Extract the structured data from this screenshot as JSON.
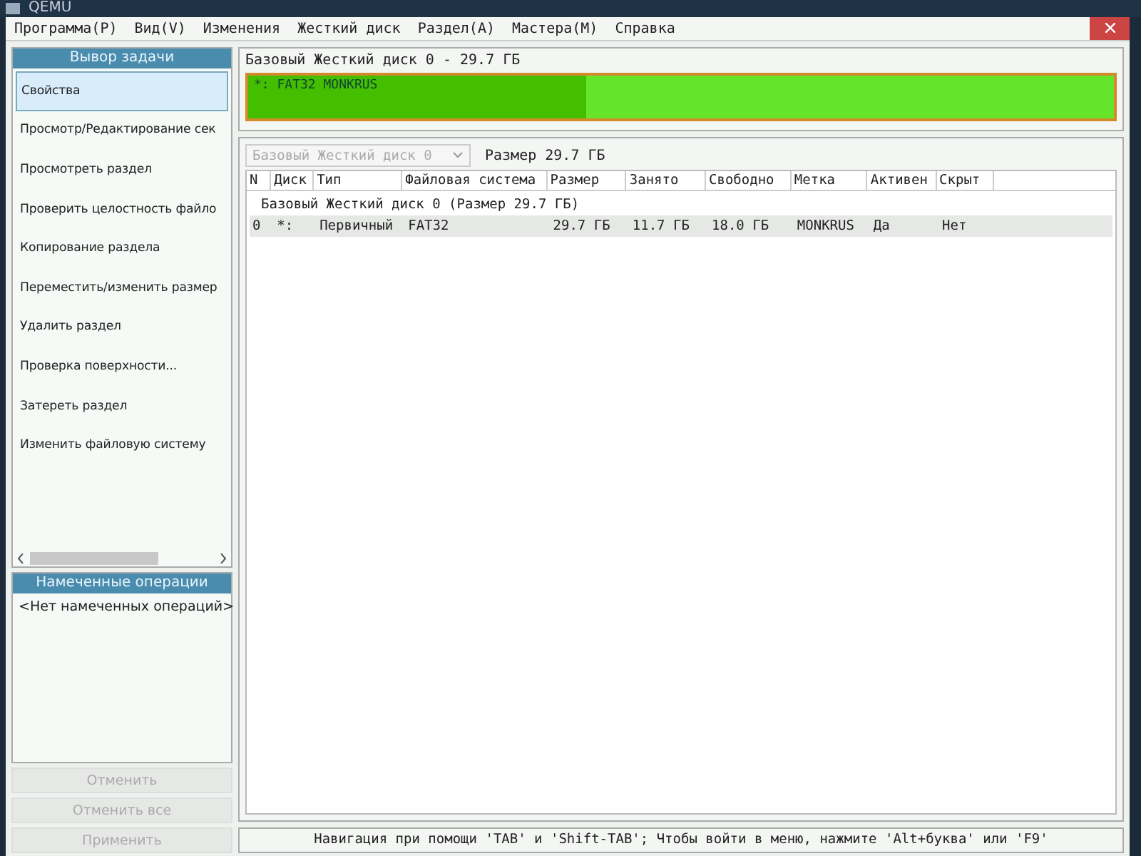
{
  "window": {
    "title": "QEMU"
  },
  "menu": [
    "Программа(P)",
    "Вид(V)",
    "Изменения",
    "Жесткий диск",
    "Раздел(A)",
    "Мастера(M)",
    "Справка"
  ],
  "task_panel": {
    "title": "Вывор задачи",
    "items": [
      {
        "label": "Свойства",
        "selected": true
      },
      {
        "label": "Просмотр/Редактирование сек",
        "selected": false
      },
      {
        "label": "Просмотреть раздел",
        "selected": false
      },
      {
        "label": "Проверить целостность файло",
        "selected": false
      },
      {
        "label": "Копирование раздела",
        "selected": false
      },
      {
        "label": "Переместить/изменить размер",
        "selected": false
      },
      {
        "label": "Удалить раздел",
        "selected": false
      },
      {
        "label": "Проверка поверхности...",
        "selected": false
      },
      {
        "label": "Затереть раздел",
        "selected": false
      },
      {
        "label": "Изменить файловую систему",
        "selected": false
      }
    ]
  },
  "pending": {
    "title": "Намеченные операции",
    "empty_text": "<Нет намеченных операций>"
  },
  "buttons": [
    {
      "label": "Отменить",
      "disabled": true
    },
    {
      "label": "Отменить все",
      "disabled": true
    },
    {
      "label": "Применить",
      "disabled": true
    }
  ],
  "disk_map": {
    "title": "Базовый Жесткий диск 0 - 29.7 ГБ",
    "partition_label": "*: FAT32 MONKRUS",
    "level": 0.39
  },
  "disk_select": {
    "value": "Базовый Жесткий диск 0",
    "disabled": true
  },
  "size_label": "Размер 29.7 ГБ",
  "table": {
    "columns": [
      "N",
      "Диск",
      "Тип",
      "Файловая система",
      "Размер",
      "Занято",
      "Свободно",
      "Метка",
      "Активен",
      "Скрыт"
    ],
    "group": "Базовый Жесткий диск 0 (Размер 29.7 ГБ)",
    "rows": [
      {
        "selected": true,
        "cells": [
          "0",
          "*:",
          "Первичный",
          "FAT32",
          "29.7 ГБ",
          "11.7 ГБ",
          "18.0 ГБ",
          "MONKRUS",
          "Да",
          "Нет"
        ]
      }
    ]
  },
  "status_bar": "Навигация при помощи 'TAB' и 'Shift-TAB'; Чтобы войти в меню, нажмите 'Alt+буква' или 'F9'"
}
